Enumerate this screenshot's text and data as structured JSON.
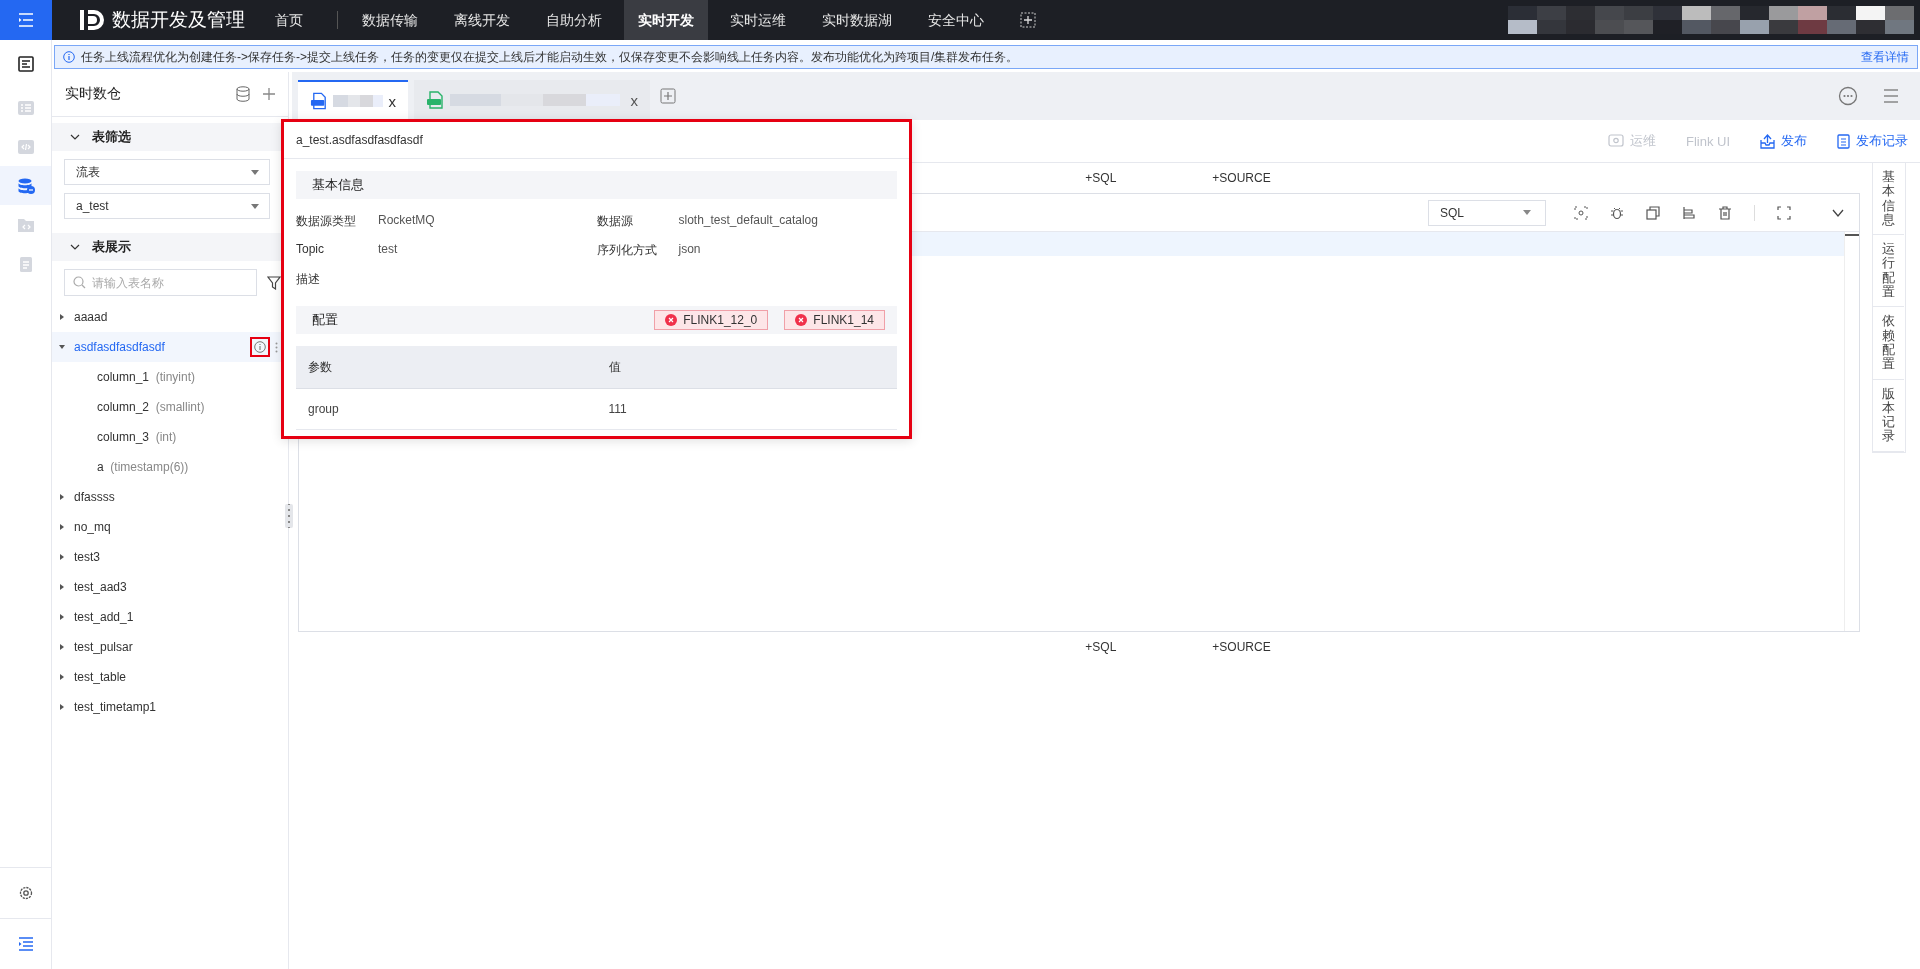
{
  "topbar": {
    "logo_text": "数据开发及管理",
    "nav": [
      {
        "label": "首页",
        "selected": false
      },
      {
        "label": "数据传输",
        "selected": false
      },
      {
        "label": "离线开发",
        "selected": false
      },
      {
        "label": "自助分析",
        "selected": false
      },
      {
        "label": "实时开发",
        "selected": true
      },
      {
        "label": "实时运维",
        "selected": false
      },
      {
        "label": "实时数据湖",
        "selected": false
      },
      {
        "label": "安全中心",
        "selected": false
      }
    ]
  },
  "rail": {
    "items": [
      {
        "kind": "list",
        "selected": false
      },
      {
        "kind": "code",
        "selected": false
      },
      {
        "kind": "database",
        "selected": true
      },
      {
        "kind": "folder",
        "selected": false
      },
      {
        "kind": "clipboard",
        "selected": false
      }
    ]
  },
  "notice": {
    "text": "任务上线流程优化为创建任务->保存任务->提交上线任务，任务的变更仅在提交上线后才能启动生效，仅保存变更不会影响线上任务内容。发布功能优化为跨项目/集群发布任务。",
    "link": "查看详情"
  },
  "sidebar": {
    "title": "实时数仓",
    "sections": [
      {
        "title": "表筛选",
        "expanded": true
      },
      {
        "title": "表展示",
        "expanded": true
      }
    ],
    "selects": [
      {
        "value": "流表"
      },
      {
        "value": "a_test"
      }
    ],
    "search": {
      "placeholder": "请输入表名称"
    },
    "tree": [
      {
        "label": "aaaad",
        "expanded": false,
        "selected": false
      },
      {
        "label": "asdfasdfasdfasdf",
        "expanded": true,
        "selected": true,
        "children": [
          {
            "name": "column_1",
            "type": "(tinyint)"
          },
          {
            "name": "column_2",
            "type": "(smallint)"
          },
          {
            "name": "column_3",
            "type": "(int)"
          },
          {
            "name": "a",
            "type": "(timestamp(6))"
          }
        ]
      },
      {
        "label": "dfassss",
        "expanded": false,
        "selected": false
      },
      {
        "label": "no_mq",
        "expanded": false,
        "selected": false
      },
      {
        "label": "test3",
        "expanded": false,
        "selected": false
      },
      {
        "label": "test_aad3",
        "expanded": false,
        "selected": false
      },
      {
        "label": "test_add_1",
        "expanded": false,
        "selected": false
      },
      {
        "label": "test_pulsar",
        "expanded": false,
        "selected": false
      },
      {
        "label": "test_table",
        "expanded": false,
        "selected": false
      },
      {
        "label": "test_timetamp1",
        "expanded": false,
        "selected": false
      }
    ]
  },
  "tabs": [
    {
      "kind": "sql",
      "selected": true,
      "close": "x"
    },
    {
      "kind": "jar",
      "selected": false,
      "close": "x"
    }
  ],
  "toolbar": [
    {
      "kind": "ops",
      "label": "运维",
      "disabled": true
    },
    {
      "kind": "flink",
      "label": "Flink UI",
      "disabled": true
    },
    {
      "kind": "publish",
      "label": "发布",
      "disabled": false
    },
    {
      "kind": "record",
      "label": "发布记录",
      "disabled": false
    }
  ],
  "editor": {
    "top_links": [
      "+SQL",
      "+SOURCE"
    ],
    "language": "SQL",
    "bottom_links": [
      "+SQL",
      "+SOURCE"
    ]
  },
  "right_tabs": [
    "基本信息",
    "运行配置",
    "依赖配置",
    "版本记录"
  ],
  "popup": {
    "title": "a_test.asdfasdfasdfasdf",
    "basic_title": "基本信息",
    "fields": [
      {
        "label": "数据源类型",
        "value": "RocketMQ"
      },
      {
        "label": "数据源",
        "value": "sloth_test_default_catalog"
      },
      {
        "label": "Topic",
        "value": "test"
      },
      {
        "label": "序列化方式",
        "value": "json"
      },
      {
        "label": "描述"
      }
    ],
    "config_title": "配置",
    "tags": [
      "FLINK1_12_0",
      "FLINK1_14"
    ],
    "table": {
      "columns": [
        "参数",
        "值"
      ],
      "rows": [
        [
          "group",
          "111"
        ]
      ]
    }
  }
}
